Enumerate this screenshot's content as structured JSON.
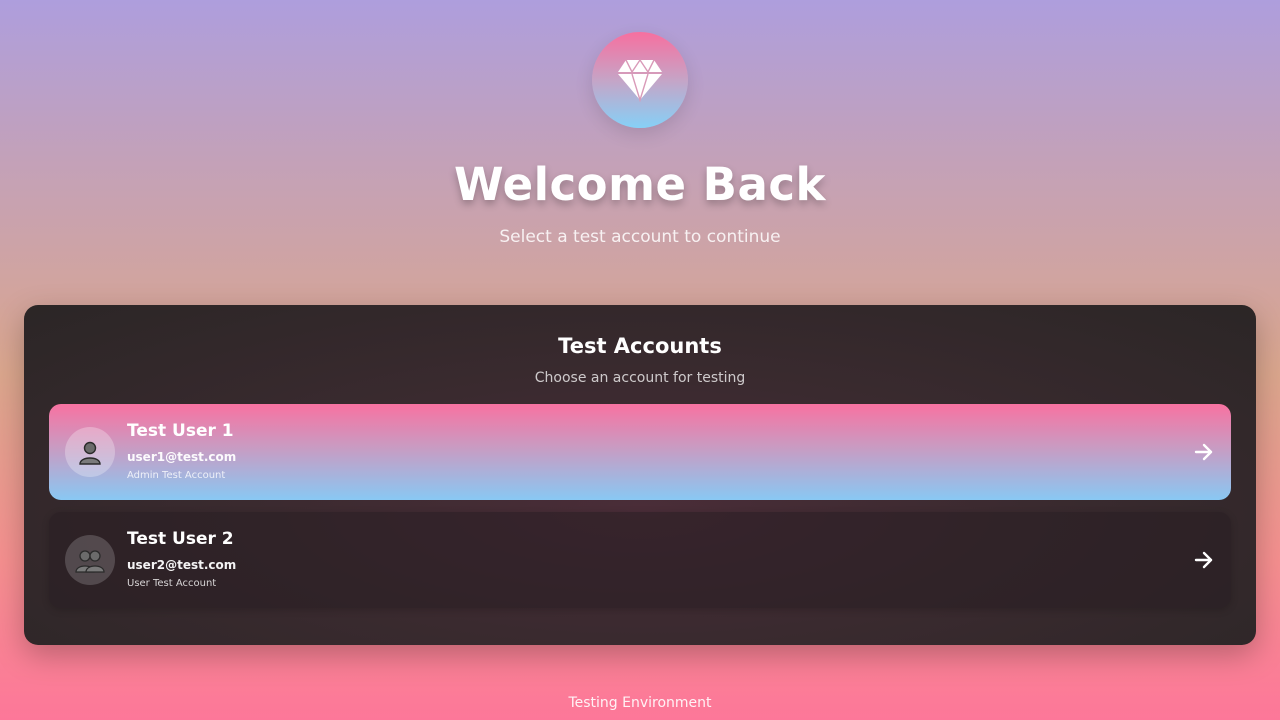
{
  "header": {
    "logo_icon": "diamond-icon",
    "title": "Welcome Back",
    "subtitle": "Select a test account to continue"
  },
  "panel": {
    "title": "Test Accounts",
    "subtitle": "Choose an account for testing",
    "accounts": [
      {
        "name": "Test User 1",
        "email": "user1@test.com",
        "role": "Admin Test Account",
        "icon": "user-icon",
        "highlighted": true
      },
      {
        "name": "Test User 2",
        "email": "user2@test.com",
        "role": "User Test Account",
        "icon": "users-icon",
        "highlighted": false
      }
    ]
  },
  "footer": {
    "text": "Testing Environment"
  },
  "colors": {
    "accent_pink": "#f872a1",
    "accent_blue": "#89c8f3",
    "panel_dark": "#2b2626"
  }
}
